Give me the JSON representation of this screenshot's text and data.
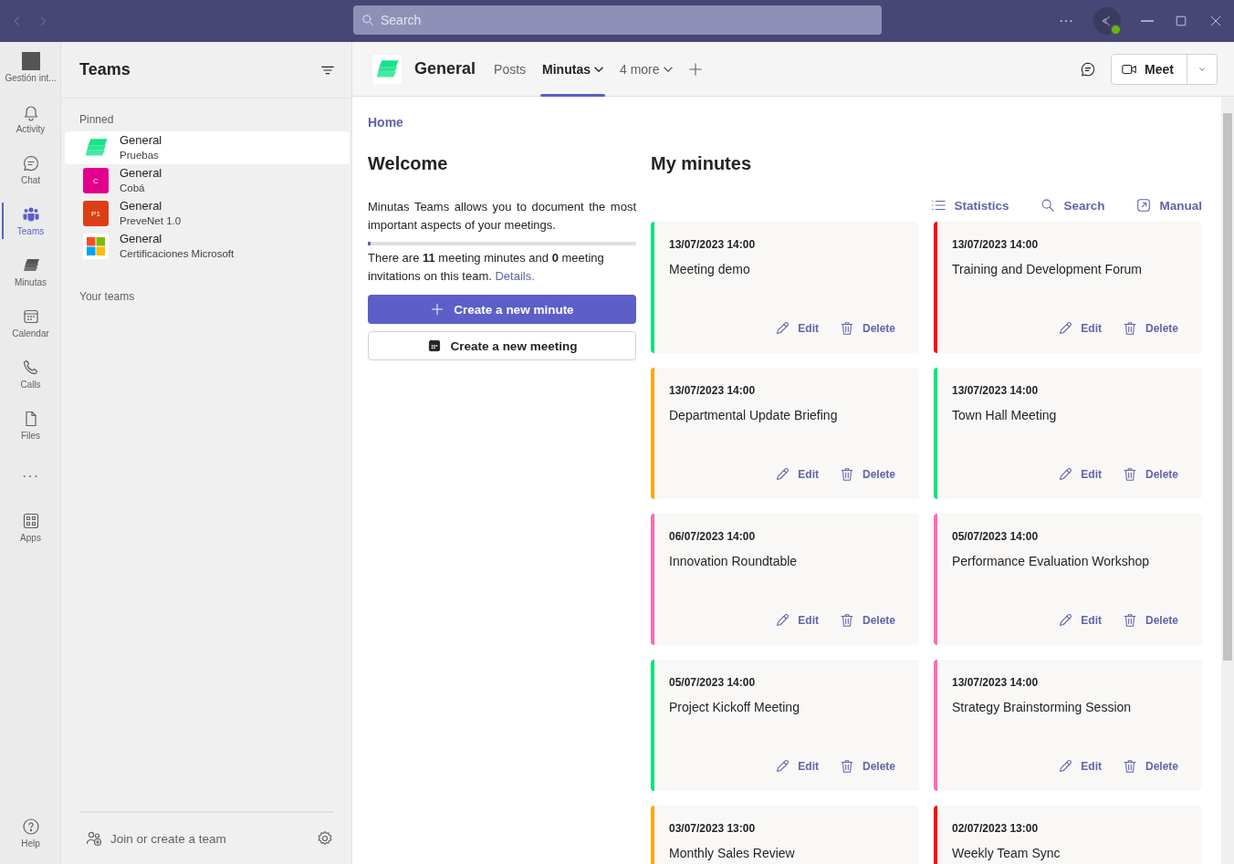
{
  "title_bar": {
    "search": {
      "placeholder": "Search"
    },
    "more": "···"
  },
  "rail": [
    {
      "kind": "org",
      "label": "Gestión int...",
      "selected": false
    },
    {
      "kind": "bell",
      "label": "Activity",
      "selected": false
    },
    {
      "kind": "chat",
      "label": "Chat",
      "selected": false
    },
    {
      "kind": "teams",
      "label": "Teams",
      "selected": true
    },
    {
      "kind": "minutas",
      "label": "Minutas",
      "selected": false
    },
    {
      "kind": "calendar",
      "label": "Calendar",
      "selected": false
    },
    {
      "kind": "calls",
      "label": "Calls",
      "selected": false
    },
    {
      "kind": "files",
      "label": "Files",
      "selected": false
    },
    {
      "kind": "more",
      "label": "···",
      "selected": false
    },
    {
      "kind": "apps",
      "label": "Apps",
      "selected": false
    }
  ],
  "rail_help": {
    "label": "Help"
  },
  "teams_panel": {
    "title": "Teams",
    "pinned_label": "Pinned",
    "pinned": [
      {
        "channel": "General",
        "team": "Pruebas",
        "kind": "logo",
        "selected": true
      },
      {
        "channel": "General",
        "team": "Cobá",
        "kind": "letter",
        "initials": "C",
        "color": "#e3008c",
        "selected": false
      },
      {
        "channel": "General",
        "team": "PreveNet 1.0",
        "kind": "letter",
        "initials": "P1",
        "color": "#dc3e15",
        "selected": false
      },
      {
        "channel": "General",
        "team": "Certificaciones Microsoft",
        "kind": "windows",
        "selected": false
      }
    ],
    "your_teams_label": "Your teams",
    "join": "Join or create a team"
  },
  "channel_header": {
    "name": "General",
    "tabs": [
      {
        "label": "Posts",
        "dropdown": false,
        "selected": false
      },
      {
        "label": "Minutas",
        "dropdown": true,
        "selected": true
      },
      {
        "label": "4 more",
        "dropdown": true,
        "selected": false
      }
    ],
    "meet": "Meet"
  },
  "content": {
    "breadcrumb": "Home",
    "welcome": {
      "title": "Welcome",
      "text": "Minutas Teams allows you to document the most important aspects of your meetings.",
      "level": 0.01,
      "summary": "There are **11** meeting minutes and **0** meeting invitations on this team.",
      "details_link": "Details.",
      "create_minute": "Create a new minute",
      "create_meeting": "Create a new meeting"
    },
    "minutes": {
      "title": "My minutes",
      "actions": [
        {
          "kind": "list",
          "label": "Statistics"
        },
        {
          "kind": "search",
          "label": "Search"
        },
        {
          "kind": "external",
          "label": "Manual"
        }
      ],
      "cards": [
        {
          "date": "13/07/2023 14:00",
          "title": "Meeting demo",
          "color": "#00e676",
          "edit": "Edit",
          "delete": "Delete"
        },
        {
          "date": "13/07/2023 14:00",
          "title": "Training and Development Forum",
          "color": "#ff0000",
          "edit": "Edit",
          "delete": "Delete"
        },
        {
          "date": "13/07/2023 14:00",
          "title": "Departmental Update Briefing",
          "color": "#ffa500",
          "edit": "Edit",
          "delete": "Delete"
        },
        {
          "date": "13/07/2023 14:00",
          "title": "Town Hall Meeting",
          "color": "#00e676",
          "edit": "Edit",
          "delete": "Delete"
        },
        {
          "date": "06/07/2023 14:00",
          "title": "Innovation Roundtable",
          "color": "#ff69b4",
          "edit": "Edit",
          "delete": "Delete"
        },
        {
          "date": "05/07/2023 14:00",
          "title": "Performance Evaluation Workshop",
          "color": "#ff69b4",
          "edit": "Edit",
          "delete": "Delete"
        },
        {
          "date": "05/07/2023 14:00",
          "title": "Project Kickoff Meeting",
          "color": "#00e676",
          "edit": "Edit",
          "delete": "Delete"
        },
        {
          "date": "13/07/2023 14:00",
          "title": "Strategy Brainstorming Session",
          "color": "#ff69b4",
          "edit": "Edit",
          "delete": "Delete"
        },
        {
          "date": "03/07/2023 13:00",
          "title": "Monthly Sales Review",
          "color": "#ffa500"
        },
        {
          "date": "02/07/2023 13:00",
          "title": "Weekly Team Sync",
          "color": "#ff0000"
        }
      ]
    }
  }
}
